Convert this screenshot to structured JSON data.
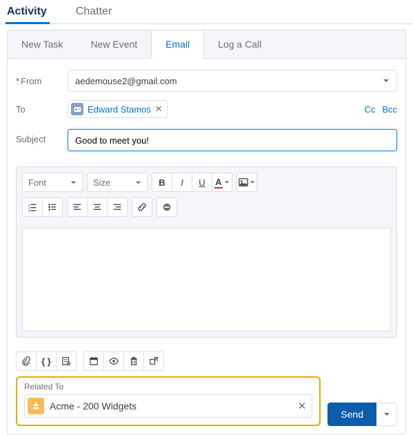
{
  "tabs": {
    "activity": "Activity",
    "chatter": "Chatter"
  },
  "subtabs": {
    "new_task": "New Task",
    "new_event": "New Event",
    "email": "Email",
    "log_call": "Log a Call"
  },
  "form": {
    "from_label": "From",
    "from_value": "aedemouse2@gmail.com",
    "to_label": "To",
    "to_chip": "Edward Stamos",
    "cc": "Cc",
    "bcc": "Bcc",
    "subject_label": "Subject",
    "subject_value": "Good to meet you!"
  },
  "toolbar": {
    "font": "Font",
    "size": "Size"
  },
  "related": {
    "label": "Related To",
    "value": "Acme - 200 Widgets"
  },
  "actions": {
    "send": "Send"
  }
}
